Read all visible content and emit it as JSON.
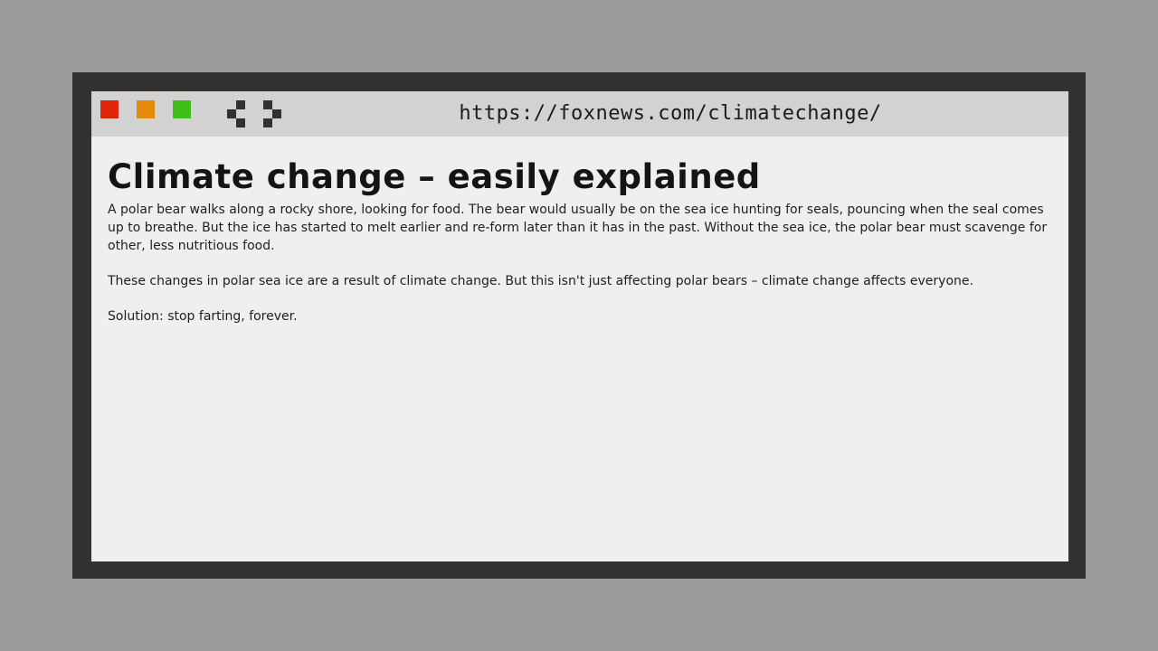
{
  "browser": {
    "url": "https://foxnews.com/climatechange/",
    "buttons": {
      "close_color": "#e0250c",
      "minimize_color": "#e68a0c",
      "maximize_color": "#3fbe1a"
    },
    "nav": {
      "back_icon": "chevron-left-icon",
      "forward_icon": "chevron-right-icon"
    }
  },
  "article": {
    "title": "Climate change – easily explained",
    "paragraphs": [
      "A polar bear walks along a rocky shore, looking for food. The bear would usually be on the sea ice hunting for seals, pouncing when the seal comes up to breathe. But the ice has started to melt earlier and re-form later than it has in the past. Without the sea ice, the polar bear must scavenge for other, less nutritious food.",
      "These changes in polar sea ice are a result of climate change. But this isn't just affecting polar bears – climate change affects everyone.",
      "Solution: stop farting, forever."
    ]
  }
}
